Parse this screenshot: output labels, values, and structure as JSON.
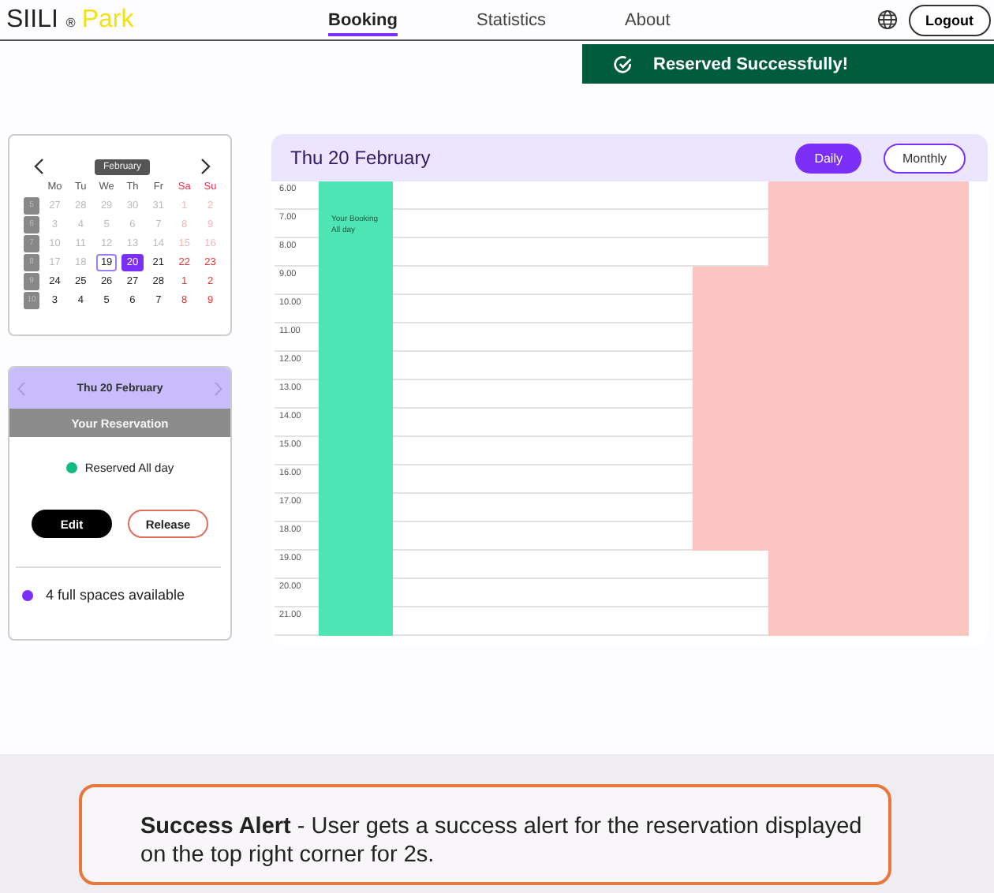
{
  "header": {
    "logo_main": "SIILI",
    "logo_mark": "®",
    "logo_accent": "Park",
    "nav": [
      {
        "label": "Booking",
        "selected": true
      },
      {
        "label": "Statistics",
        "selected": false
      },
      {
        "label": "About",
        "selected": false
      }
    ],
    "logout": "Logout"
  },
  "toast": {
    "text": "Reserved Successfully!"
  },
  "calendar": {
    "month": "February",
    "weekdays": [
      {
        "label": "Mo",
        "weekend": false
      },
      {
        "label": "Tu",
        "weekend": false
      },
      {
        "label": "We",
        "weekend": false
      },
      {
        "label": "Th",
        "weekend": false
      },
      {
        "label": "Fr",
        "weekend": false
      },
      {
        "label": "Sa",
        "weekend": true
      },
      {
        "label": "Su",
        "weekend": true
      }
    ],
    "weeks": [
      {
        "week": "5",
        "days": [
          {
            "label": "27",
            "past": true,
            "weekend": false,
            "today": false,
            "selected": false
          },
          {
            "label": "28",
            "past": true,
            "weekend": false,
            "today": false,
            "selected": false
          },
          {
            "label": "29",
            "past": true,
            "weekend": false,
            "today": false,
            "selected": false
          },
          {
            "label": "30",
            "past": true,
            "weekend": false,
            "today": false,
            "selected": false
          },
          {
            "label": "31",
            "past": true,
            "weekend": false,
            "today": false,
            "selected": false
          },
          {
            "label": "1",
            "past": true,
            "weekend": true,
            "today": false,
            "selected": false
          },
          {
            "label": "2",
            "past": true,
            "weekend": true,
            "today": false,
            "selected": false
          }
        ]
      },
      {
        "week": "6",
        "days": [
          {
            "label": "3",
            "past": true,
            "weekend": false,
            "today": false,
            "selected": false
          },
          {
            "label": "4",
            "past": true,
            "weekend": false,
            "today": false,
            "selected": false
          },
          {
            "label": "5",
            "past": true,
            "weekend": false,
            "today": false,
            "selected": false
          },
          {
            "label": "6",
            "past": true,
            "weekend": false,
            "today": false,
            "selected": false
          },
          {
            "label": "7",
            "past": true,
            "weekend": false,
            "today": false,
            "selected": false
          },
          {
            "label": "8",
            "past": true,
            "weekend": true,
            "today": false,
            "selected": false
          },
          {
            "label": "9",
            "past": true,
            "weekend": true,
            "today": false,
            "selected": false
          }
        ]
      },
      {
        "week": "7",
        "days": [
          {
            "label": "10",
            "past": true,
            "weekend": false,
            "today": false,
            "selected": false
          },
          {
            "label": "11",
            "past": true,
            "weekend": false,
            "today": false,
            "selected": false
          },
          {
            "label": "12",
            "past": true,
            "weekend": false,
            "today": false,
            "selected": false
          },
          {
            "label": "13",
            "past": true,
            "weekend": false,
            "today": false,
            "selected": false
          },
          {
            "label": "14",
            "past": true,
            "weekend": false,
            "today": false,
            "selected": false
          },
          {
            "label": "15",
            "past": true,
            "weekend": true,
            "today": false,
            "selected": false
          },
          {
            "label": "16",
            "past": true,
            "weekend": true,
            "today": false,
            "selected": false
          }
        ]
      },
      {
        "week": "8",
        "days": [
          {
            "label": "17",
            "past": true,
            "weekend": false,
            "today": false,
            "selected": false
          },
          {
            "label": "18",
            "past": true,
            "weekend": false,
            "today": false,
            "selected": false
          },
          {
            "label": "19",
            "past": false,
            "weekend": false,
            "today": true,
            "selected": false
          },
          {
            "label": "20",
            "past": false,
            "weekend": false,
            "today": false,
            "selected": true
          },
          {
            "label": "21",
            "past": false,
            "weekend": false,
            "today": false,
            "selected": false
          },
          {
            "label": "22",
            "past": false,
            "weekend": true,
            "today": false,
            "selected": false
          },
          {
            "label": "23",
            "past": false,
            "weekend": true,
            "today": false,
            "selected": false
          }
        ]
      },
      {
        "week": "9",
        "days": [
          {
            "label": "24",
            "past": false,
            "weekend": false,
            "today": false,
            "selected": false
          },
          {
            "label": "25",
            "past": false,
            "weekend": false,
            "today": false,
            "selected": false
          },
          {
            "label": "26",
            "past": false,
            "weekend": false,
            "today": false,
            "selected": false
          },
          {
            "label": "27",
            "past": false,
            "weekend": false,
            "today": false,
            "selected": false
          },
          {
            "label": "28",
            "past": false,
            "weekend": false,
            "today": false,
            "selected": false
          },
          {
            "label": "1",
            "past": false,
            "weekend": true,
            "today": false,
            "selected": false
          },
          {
            "label": "2",
            "past": false,
            "weekend": true,
            "today": false,
            "selected": false
          }
        ]
      },
      {
        "week": "10",
        "days": [
          {
            "label": "3",
            "past": false,
            "weekend": false,
            "today": false,
            "selected": false
          },
          {
            "label": "4",
            "past": false,
            "weekend": false,
            "today": false,
            "selected": false
          },
          {
            "label": "5",
            "past": false,
            "weekend": false,
            "today": false,
            "selected": false
          },
          {
            "label": "6",
            "past": false,
            "weekend": false,
            "today": false,
            "selected": false
          },
          {
            "label": "7",
            "past": false,
            "weekend": false,
            "today": false,
            "selected": false
          },
          {
            "label": "8",
            "past": false,
            "weekend": true,
            "today": false,
            "selected": false
          },
          {
            "label": "9",
            "past": false,
            "weekend": true,
            "today": false,
            "selected": false
          }
        ]
      }
    ]
  },
  "reservation": {
    "date": "Thu 20 February",
    "heading": "Your Reservation",
    "status": {
      "text": "Reserved All day",
      "color": "#12b981"
    },
    "edit": "Edit",
    "release": "Release",
    "availability": {
      "text": "4 full spaces available",
      "color": "#7b2ff7"
    }
  },
  "schedule": {
    "title": "Thu 20 February",
    "views": [
      {
        "label": "Daily",
        "selected": true
      },
      {
        "label": "Monthly",
        "selected": false
      }
    ],
    "rows": [
      {
        "time": "6.00",
        "cells": [
          {
            "kind": "mine"
          },
          {
            "kind": "free"
          },
          {
            "kind": "free"
          },
          {
            "kind": "taken"
          }
        ]
      },
      {
        "time": "7.00",
        "cells": [
          {
            "kind": "mine",
            "note": [
              "Your Booking",
              "All day"
            ]
          },
          {
            "kind": "free"
          },
          {
            "kind": "free"
          },
          {
            "kind": "taken"
          }
        ]
      },
      {
        "time": "8.00",
        "cells": [
          {
            "kind": "mine"
          },
          {
            "kind": "free"
          },
          {
            "kind": "free"
          },
          {
            "kind": "taken"
          }
        ]
      },
      {
        "time": "9.00",
        "cells": [
          {
            "kind": "mine"
          },
          {
            "kind": "free"
          },
          {
            "kind": "taken"
          },
          {
            "kind": "taken"
          }
        ]
      },
      {
        "time": "10.00",
        "cells": [
          {
            "kind": "mine"
          },
          {
            "kind": "free"
          },
          {
            "kind": "taken"
          },
          {
            "kind": "taken"
          }
        ]
      },
      {
        "time": "11.00",
        "cells": [
          {
            "kind": "mine"
          },
          {
            "kind": "free"
          },
          {
            "kind": "taken"
          },
          {
            "kind": "taken"
          }
        ]
      },
      {
        "time": "12.00",
        "cells": [
          {
            "kind": "mine"
          },
          {
            "kind": "free"
          },
          {
            "kind": "taken"
          },
          {
            "kind": "taken"
          }
        ]
      },
      {
        "time": "13.00",
        "cells": [
          {
            "kind": "mine"
          },
          {
            "kind": "free"
          },
          {
            "kind": "taken"
          },
          {
            "kind": "taken"
          }
        ]
      },
      {
        "time": "14.00",
        "cells": [
          {
            "kind": "mine"
          },
          {
            "kind": "free"
          },
          {
            "kind": "taken"
          },
          {
            "kind": "taken"
          }
        ]
      },
      {
        "time": "15.00",
        "cells": [
          {
            "kind": "mine"
          },
          {
            "kind": "free"
          },
          {
            "kind": "taken"
          },
          {
            "kind": "taken"
          }
        ]
      },
      {
        "time": "16.00",
        "cells": [
          {
            "kind": "mine"
          },
          {
            "kind": "free"
          },
          {
            "kind": "taken"
          },
          {
            "kind": "taken"
          }
        ]
      },
      {
        "time": "17.00",
        "cells": [
          {
            "kind": "mine"
          },
          {
            "kind": "free"
          },
          {
            "kind": "taken"
          },
          {
            "kind": "taken"
          }
        ]
      },
      {
        "time": "18.00",
        "cells": [
          {
            "kind": "mine"
          },
          {
            "kind": "free"
          },
          {
            "kind": "taken"
          },
          {
            "kind": "taken"
          }
        ]
      },
      {
        "time": "19.00",
        "cells": [
          {
            "kind": "mine"
          },
          {
            "kind": "free"
          },
          {
            "kind": "free"
          },
          {
            "kind": "taken"
          }
        ]
      },
      {
        "time": "20.00",
        "cells": [
          {
            "kind": "mine"
          },
          {
            "kind": "free"
          },
          {
            "kind": "free"
          },
          {
            "kind": "taken"
          }
        ]
      },
      {
        "time": "21.00",
        "cells": [
          {
            "kind": "mine"
          },
          {
            "kind": "free"
          },
          {
            "kind": "free"
          },
          {
            "kind": "taken"
          }
        ]
      }
    ]
  },
  "annotation": {
    "text": "**Success Alert** - User gets a success alert for the reservation displayed on the top right corner for 2s."
  }
}
